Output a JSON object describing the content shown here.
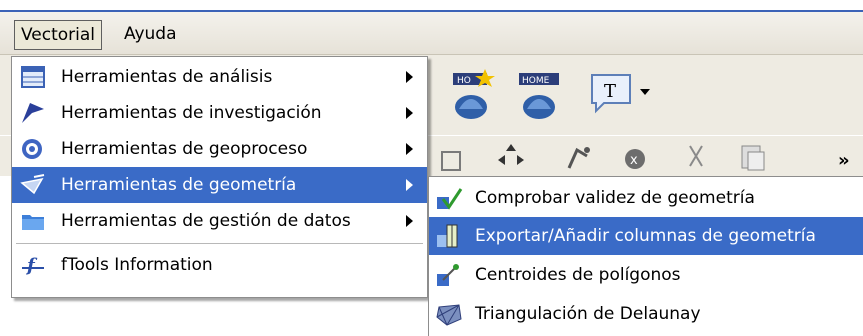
{
  "menubar": {
    "items": [
      {
        "label": "Vectorial"
      },
      {
        "label": "Ayuda"
      }
    ]
  },
  "toolbar": {
    "text_tool_label": "T",
    "overflow_label": "»"
  },
  "dropdown": {
    "items": [
      {
        "label": "Herramientas de análisis",
        "icon": "table-icon",
        "submenu": true
      },
      {
        "label": "Herramientas de investigación",
        "icon": "flag-icon",
        "submenu": true
      },
      {
        "label": "Herramientas de geoproceso",
        "icon": "gear-icon",
        "submenu": true
      },
      {
        "label": "Herramientas de geometría",
        "icon": "geometry-icon",
        "submenu": true,
        "highlighted": true
      },
      {
        "label": "Herramientas de gestión de datos",
        "icon": "folder-icon",
        "submenu": true
      },
      {
        "label": "fTools Information",
        "icon": "ftools-icon",
        "submenu": false
      }
    ]
  },
  "submenu": {
    "items": [
      {
        "label": "Comprobar validez de geometría",
        "icon": "check-geometry-icon"
      },
      {
        "label": "Exportar/Añadir columnas de geometría",
        "icon": "export-columns-icon",
        "highlighted": true
      },
      {
        "label": "Centroides de polígonos",
        "icon": "centroid-icon"
      },
      {
        "label": "Triangulación de Delaunay",
        "icon": "delaunay-icon"
      }
    ]
  },
  "colors": {
    "highlight": "#3a6bc7",
    "title_blue": "#3c63b7"
  }
}
